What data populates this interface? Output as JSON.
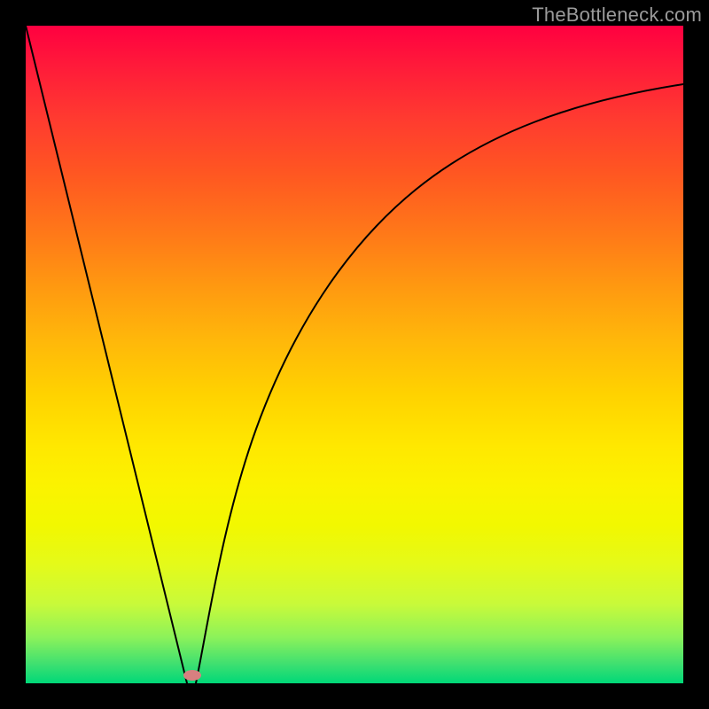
{
  "watermark": "TheBottleneck.com",
  "colors": {
    "frame": "#000000",
    "curve": "#000000",
    "dot": "#d88080",
    "gradient_stops": [
      "#ff0040",
      "#ff1a3a",
      "#ff3a30",
      "#ff5522",
      "#ff7a18",
      "#ff9a10",
      "#ffb80a",
      "#ffd200",
      "#ffe800",
      "#fbf300",
      "#f2f800",
      "#e4fa1a",
      "#c8fa3a",
      "#8cf25a",
      "#40e070",
      "#00d878"
    ]
  },
  "chart_data": {
    "type": "line",
    "title": "",
    "xlabel": "",
    "ylabel": "",
    "xlim": [
      0,
      1
    ],
    "ylim": [
      0,
      1
    ],
    "legend": false,
    "grid": false,
    "annotations": [
      {
        "text": "TheBottleneck.com",
        "pos": "top-right"
      }
    ],
    "series": [
      {
        "name": "falling-line",
        "x": [
          0.0,
          0.05,
          0.1,
          0.15,
          0.2,
          0.245
        ],
        "values": [
          1.0,
          0.795,
          0.59,
          0.385,
          0.18,
          0.0
        ]
      },
      {
        "name": "rising-curve",
        "x": [
          0.26,
          0.28,
          0.3,
          0.33,
          0.36,
          0.4,
          0.45,
          0.5,
          0.55,
          0.6,
          0.65,
          0.7,
          0.75,
          0.8,
          0.85,
          0.9,
          0.95,
          1.0
        ],
        "values": [
          0.0,
          0.08,
          0.16,
          0.26,
          0.35,
          0.45,
          0.55,
          0.63,
          0.695,
          0.745,
          0.785,
          0.817,
          0.843,
          0.863,
          0.88,
          0.893,
          0.903,
          0.912
        ]
      }
    ],
    "marker": {
      "x": 0.255,
      "y": 0.005
    }
  }
}
